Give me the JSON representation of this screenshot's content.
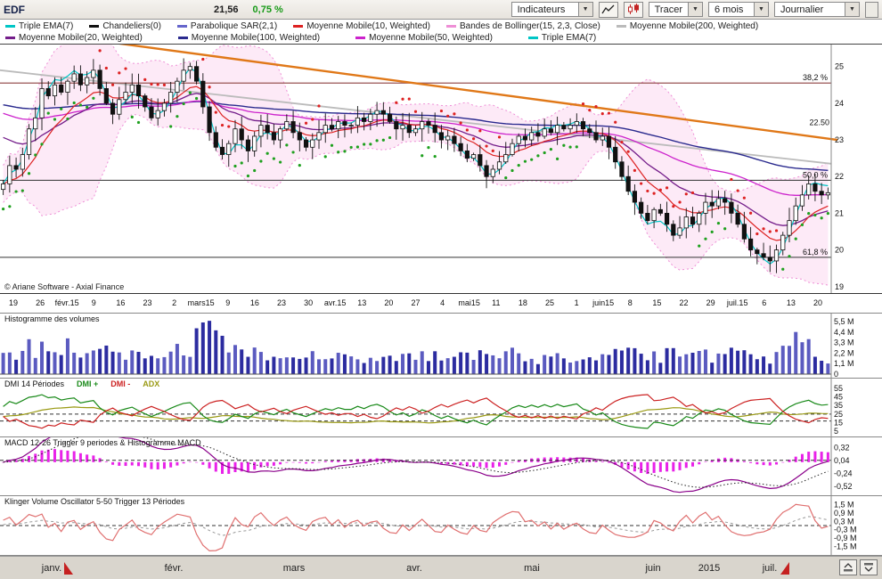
{
  "toolbar": {
    "symbol": "EDF",
    "price": "21,56",
    "change": "0,75 %",
    "indicators_label": "Indicateurs",
    "tracer_label": "Tracer",
    "period_label": "6 mois",
    "timeframe_label": "Journalier"
  },
  "icons": {
    "dropdown_arrow": "▼"
  },
  "legend": {
    "row1": [
      {
        "label": "Triple EMA(7)",
        "color": "#00c6c6"
      },
      {
        "label": "Chandeliers(0)",
        "color": "#111111"
      },
      {
        "label": "Parabolique SAR(2,1)",
        "color": "#6666cc"
      },
      {
        "label": "Moyenne Mobile(10, Weighted)",
        "color": "#dd2222"
      },
      {
        "label": "Bandes de Bollinger(15, 2,3, Close)",
        "color": "#ee8fd6"
      },
      {
        "label": "Moyenne Mobile(200, Weighted)",
        "color": "#bbbbbb"
      }
    ],
    "row2": [
      {
        "label": "Moyenne Mobile(20, Weighted)",
        "color": "#741d8a"
      },
      {
        "label": "Moyenne Mobile(100, Weighted)",
        "color": "#2a2a8e"
      },
      {
        "label": "Moyenne Mobile(50, Weighted)",
        "color": "#cc22cc"
      },
      {
        "label": "Triple EMA(7)",
        "color": "#00c6c6"
      }
    ]
  },
  "copyright": "© Ariane Software - Axial Finance",
  "chart_data": {
    "type": "candlestick",
    "x_tick_labels": [
      "19",
      "26",
      "févr.15",
      "9",
      "16",
      "23",
      "2",
      "mars15",
      "9",
      "16",
      "23",
      "30",
      "avr.15",
      "13",
      "20",
      "27",
      "4",
      "mai15",
      "11",
      "18",
      "25",
      "1",
      "juin15",
      "8",
      "15",
      "22",
      "29",
      "juil.15",
      "6",
      "13",
      "20"
    ],
    "main": {
      "ylim": [
        18.8,
        25.6
      ],
      "y_ticks": [
        25,
        24,
        23,
        22,
        21,
        20,
        19
      ],
      "fib_levels": [
        {
          "label": "38,2 %",
          "value": 24.55,
          "color": "#995555",
          "width": 1.2
        },
        {
          "label": "50,0 %",
          "value": 21.9,
          "color": "#333333",
          "width": 1
        },
        {
          "label": "61,8 %",
          "value": 19.8,
          "color": "#333333",
          "width": 1
        }
      ],
      "trendline": {
        "label": "22.50",
        "label_value": 23.35,
        "start_value": 25.95,
        "end_value": 23.0,
        "color": "#e07818"
      },
      "ma200_approx": [
        24.9,
        22.35
      ],
      "closes": [
        21.8,
        22.3,
        22.2,
        22.6,
        23.3,
        23.6,
        24.4,
        24.2,
        24.5,
        24.3,
        24.6,
        24.8,
        24.5,
        24.7,
        24.9,
        24.4,
        24.0,
        23.7,
        24.1,
        24.3,
        24.5,
        24.2,
        23.9,
        23.6,
        23.8,
        24.0,
        24.3,
        24.6,
        24.9,
        25.0,
        24.6,
        23.9,
        23.2,
        22.8,
        22.6,
        22.9,
        23.3,
        23.0,
        22.7,
        23.1,
        23.4,
        23.2,
        23.0,
        23.3,
        23.5,
        23.2,
        23.0,
        22.8,
        23.0,
        23.2,
        23.4,
        23.3,
        23.5,
        23.4,
        23.4,
        23.6,
        23.5,
        23.7,
        23.8,
        23.7,
        23.5,
        23.3,
        23.4,
        23.2,
        23.3,
        23.5,
        23.4,
        23.2,
        23.0,
        23.1,
        22.9,
        22.7,
        22.5,
        22.6,
        22.3,
        22.0,
        22.2,
        22.4,
        22.6,
        22.9,
        23.1,
        23.0,
        23.2,
        23.1,
        23.3,
        23.2,
        23.4,
        23.3,
        23.4,
        23.5,
        23.3,
        23.2,
        23.0,
        23.1,
        22.8,
        22.4,
        22.0,
        21.6,
        21.3,
        21.0,
        20.8,
        21.1,
        21.0,
        20.7,
        20.4,
        20.6,
        20.9,
        20.7,
        21.0,
        21.3,
        21.2,
        21.4,
        21.3,
        21.0,
        20.7,
        20.3,
        20.0,
        19.9,
        19.8,
        19.7,
        20.0,
        20.4,
        20.8,
        21.2,
        21.5,
        21.8,
        21.6,
        21.5,
        21.56
      ]
    },
    "volume": {
      "title": "Histogramme des volumes",
      "y_ticks": [
        {
          "v": 5.5,
          "label": "5,5 M"
        },
        {
          "v": 4.4,
          "label": "4,4 M"
        },
        {
          "v": 3.3,
          "label": "3,3 M"
        },
        {
          "v": 2.2,
          "label": "2,2 M"
        },
        {
          "v": 1.1,
          "label": "1,1 M"
        },
        {
          "v": 0,
          "label": "0"
        }
      ]
    },
    "dmi": {
      "title": "DMI 14 Périodes",
      "series_labels": [
        {
          "label": "DMI +",
          "color": "#1a8a1a"
        },
        {
          "label": "DMI -",
          "color": "#cc2222"
        },
        {
          "label": "ADX",
          "color": "#9a9a14"
        }
      ],
      "y_ticks": [
        55,
        45,
        35,
        25,
        15,
        5
      ],
      "ref_lines": [
        25,
        17
      ]
    },
    "macd": {
      "title": "MACD 12-26   Trigger 9 periodes & Histogramme MACD",
      "y_ticks": [
        {
          "v": 0.32,
          "label": "0,32"
        },
        {
          "v": 0.04,
          "label": "0,04"
        },
        {
          "v": -0.24,
          "label": "-0,24"
        },
        {
          "v": -0.52,
          "label": "-0,52"
        }
      ],
      "ref_line": 0.04
    },
    "klinger": {
      "title": "Klinger Volume Oscillator 5-50   Trigger 13 Périodes",
      "y_ticks": [
        {
          "v": 1.5,
          "label": "1,5 M"
        },
        {
          "v": 0.9,
          "label": "0,9 M"
        },
        {
          "v": 0.3,
          "label": "0,3 M"
        },
        {
          "v": -0.3,
          "label": "-0,3 M"
        },
        {
          "v": -0.9,
          "label": "-0,9 M"
        },
        {
          "v": -1.5,
          "label": "-1,5 M"
        }
      ],
      "ref_line": 0
    },
    "colors": {
      "change_green": "#179a17",
      "volume_bar": "#2c2ca0",
      "macd_histogram": "#e822e8",
      "klinger_line": "#e07070",
      "bollinger_fill": "#fbdcf1",
      "trendline_orange": "#e07818"
    }
  },
  "bottom_bar": {
    "months": [
      "janv.",
      "févr.",
      "mars",
      "avr.",
      "mai",
      "juin",
      "juil."
    ],
    "year": "2015"
  }
}
